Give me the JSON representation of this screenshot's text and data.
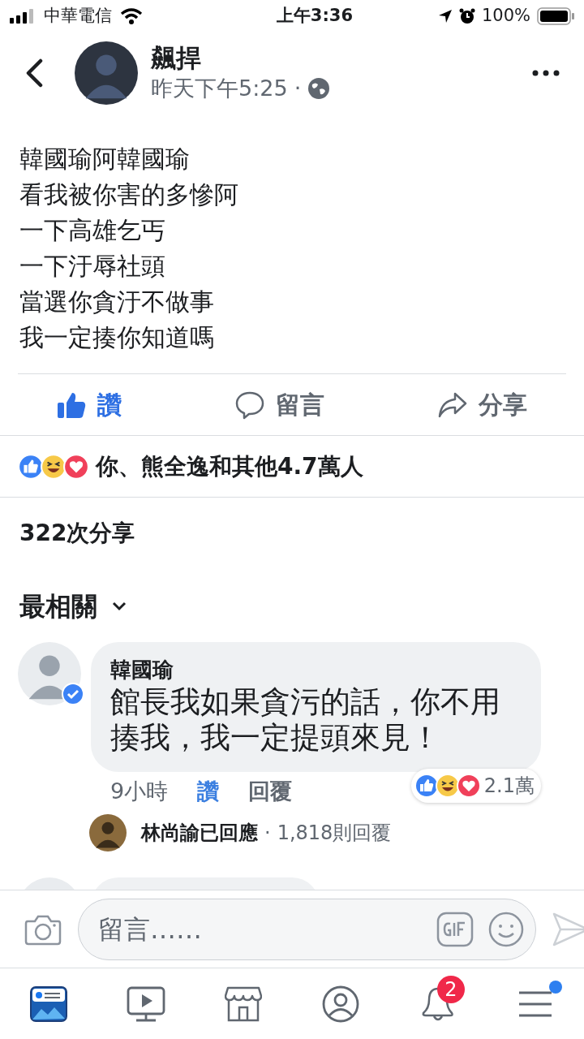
{
  "status_bar": {
    "carrier": "中華電信",
    "time": "上午3:36",
    "battery": "100%"
  },
  "post": {
    "author": "飆捍",
    "timestamp": "昨天下午5:25",
    "separator": "·",
    "lines": [
      "韓國瑜阿韓國瑜",
      "看我被你害的多慘阿",
      "一下高雄乞丐",
      "一下汙辱社頭",
      "當選你貪汙不做事",
      "我一定揍你知道嗎"
    ],
    "actions": [
      {
        "kind": "like",
        "label": "讚",
        "selected": true
      },
      {
        "kind": "comment",
        "label": "留言",
        "selected": false
      },
      {
        "kind": "share",
        "label": "分享",
        "selected": false
      }
    ],
    "reactions_summary": "你、熊全逸和其他4.7萬人",
    "shares": "322次分享"
  },
  "comments_header": {
    "label": "最相關"
  },
  "comments": [
    {
      "author": "韓國瑜",
      "verified": true,
      "text": "館長我如果貪污的話，你不用揍我，我一定提頭來見！",
      "time": "9小時",
      "actions": [
        {
          "label": "讚",
          "selected": true
        },
        {
          "label": "回覆",
          "selected": false
        }
      ],
      "reaction_count": "2.1萬",
      "reply_summary": {
        "text": "林尚諭已回應",
        "separator": "·",
        "count": "1,818則回覆"
      }
    }
  ],
  "composer": {
    "placeholder": "留言……"
  },
  "tabs": [
    {
      "kind": "feed",
      "selected": true
    },
    {
      "kind": "watch",
      "selected": false
    },
    {
      "kind": "marketplace",
      "selected": false
    },
    {
      "kind": "profile",
      "selected": false
    },
    {
      "kind": "notifications",
      "selected": false,
      "badge": "2"
    },
    {
      "kind": "menu",
      "selected": false,
      "dot": true
    }
  ]
}
